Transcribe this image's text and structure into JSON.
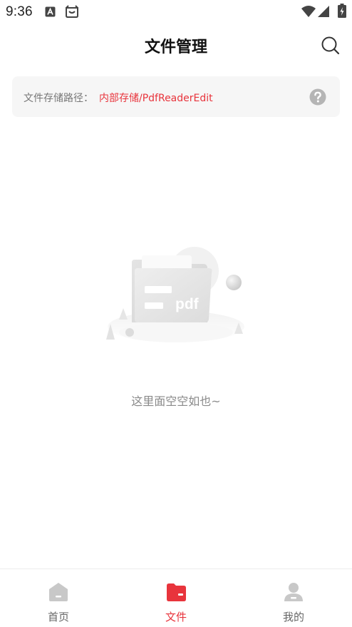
{
  "status_bar": {
    "time": "9:36",
    "icons": [
      "text-notification-icon",
      "android-notification-icon",
      "wifi-icon",
      "signal-icon",
      "battery-charging-icon"
    ]
  },
  "header": {
    "title": "文件管理",
    "search_icon": "search-icon"
  },
  "path_bar": {
    "label": "文件存储路径：",
    "value": "内部存储/PdfReaderEdit",
    "help_icon": "help-icon"
  },
  "empty_state": {
    "illustration_text": "pdf",
    "message": "这里面空空如也~"
  },
  "bottom_nav": {
    "items": [
      {
        "label": "首页",
        "icon": "home-icon",
        "active": false
      },
      {
        "label": "文件",
        "icon": "folder-icon",
        "active": true
      },
      {
        "label": "我的",
        "icon": "profile-icon",
        "active": false
      }
    ]
  },
  "colors": {
    "accent": "#e8343c",
    "inactive": "#666666",
    "path_bar_bg": "#f6f6f6"
  }
}
